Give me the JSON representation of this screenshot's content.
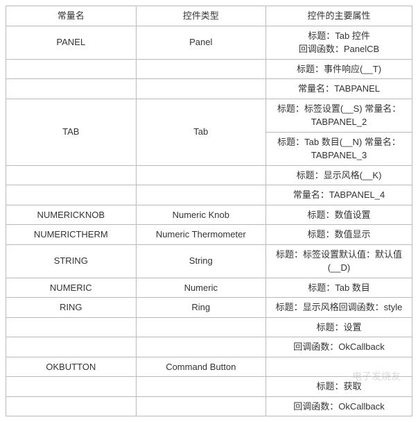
{
  "headers": {
    "col1": "常量名",
    "col2": "控件类型",
    "col3": "控件的主要属性"
  },
  "rows": [
    {
      "c1": "PANEL",
      "c1_rowspan": 1,
      "c2": "Panel",
      "c2_rowspan": 1,
      "c3": "标题：Tab 控件\n回调函数：PanelCB"
    },
    {
      "c1": "",
      "c2": "",
      "c3": "标题：事件响应(__T)"
    },
    {
      "c1": "",
      "c2": "",
      "c3": "常量名：TABPANEL"
    },
    {
      "c1": "TAB",
      "c1_rowspan": 2,
      "c2": "Tab",
      "c2_rowspan": 2,
      "c3": "标题：标签设置(__S) 常量名：TABPANEL_2"
    },
    {
      "c3": "标题：Tab 数目(__N) 常量名：TABPANEL_3"
    },
    {
      "c1": "",
      "c2": "",
      "c3": "标题：显示风格(__K)"
    },
    {
      "c1": "",
      "c2": "",
      "c3": "常量名：TABPANEL_4"
    },
    {
      "c1": "NUMERICKNOB",
      "c2": "Numeric Knob",
      "c3": "标题：数值设置"
    },
    {
      "c1": "NUMERICTHERM",
      "c2": "Numeric Thermometer",
      "c3": "标题：数值显示"
    },
    {
      "c1": "STRING",
      "c2": "String",
      "c3": "标题：标签设置默认值：默认值(__D)"
    },
    {
      "c1": "NUMERIC",
      "c2": "Numeric",
      "c3": "标题：Tab 数目"
    },
    {
      "c1": "RING",
      "c2": "Ring",
      "c3": "标题：显示风格回调函数：style"
    },
    {
      "c1": "",
      "c2": "",
      "c3": "标题：设置"
    },
    {
      "c1": "",
      "c2": "",
      "c3": "回调函数：OkCallback"
    },
    {
      "c1": "OKBUTTON",
      "c1_rowspan": 1,
      "c2": "Command Button",
      "c2_rowspan": 1,
      "c3": ""
    },
    {
      "c1": "",
      "c2": "",
      "c3": "标题：获取"
    },
    {
      "c1": "",
      "c2": "",
      "c3": "回调函数：OkCallback"
    }
  ],
  "watermark": "电子发烧友"
}
